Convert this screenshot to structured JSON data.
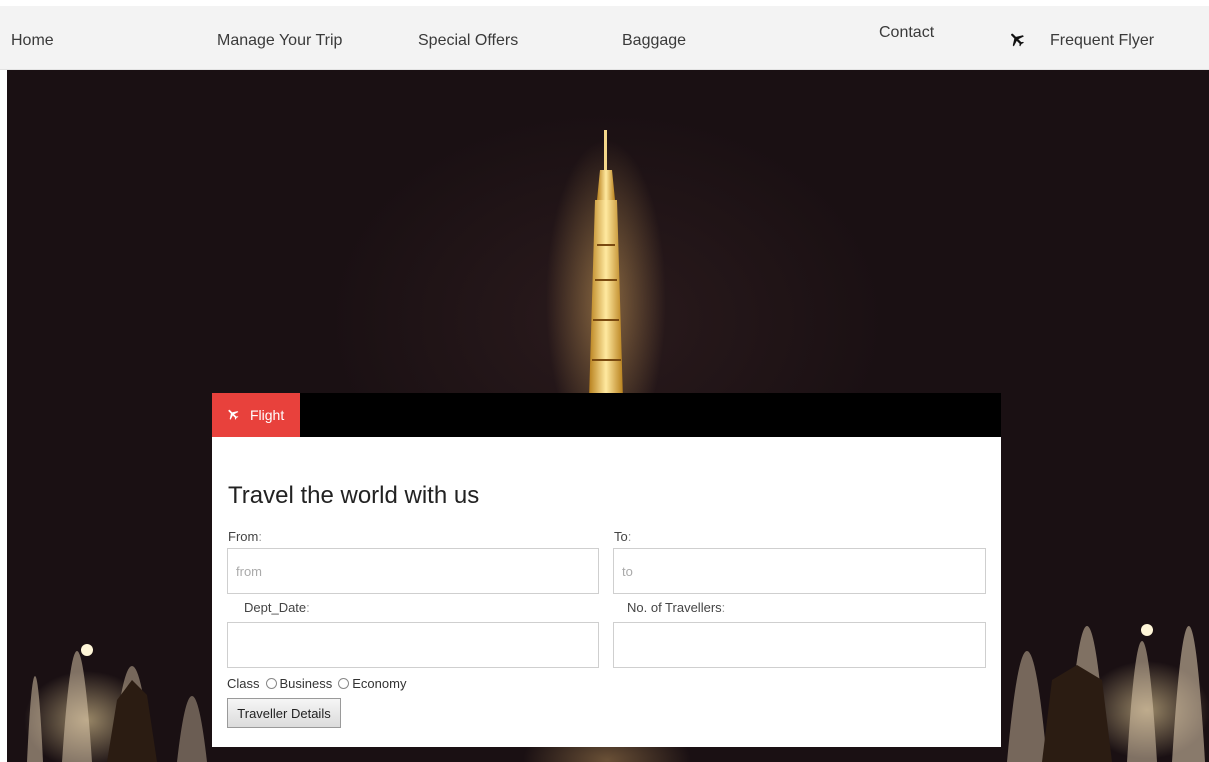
{
  "nav": {
    "home": "Home",
    "manage": "Manage Your Trip",
    "offers": "Special Offers",
    "baggage": "Baggage",
    "contact": "Contact",
    "frequent_flyer": "Frequent Flyer"
  },
  "booking": {
    "tab_label": "Flight",
    "title": "Travel the world with us",
    "from_label": "From",
    "to_label": "To",
    "dept_label": "Dept_Date",
    "travellers_label": "No. of Travellers",
    "colon": ":",
    "from_placeholder": "from",
    "to_placeholder": "to",
    "class_label": "Class",
    "class_options": [
      "Business",
      "Economy"
    ],
    "submit_label": "Traveller Details"
  },
  "colors": {
    "accent": "#e8413c",
    "tabbar": "#000000",
    "navbar": "#f3f3f3"
  },
  "icons": [
    "plane-icon"
  ]
}
